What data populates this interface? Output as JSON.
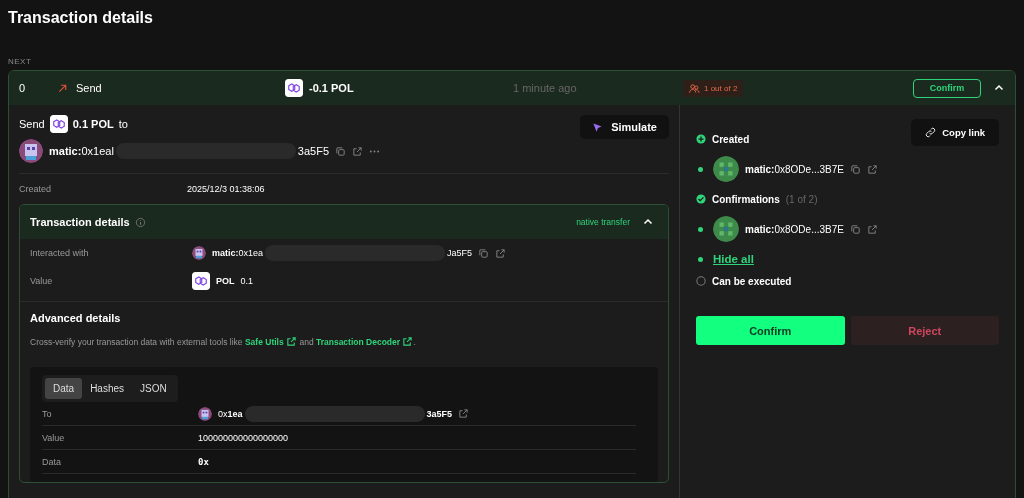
{
  "page_title": "Transaction details",
  "queue_label": "NEXT",
  "transaction": {
    "nonce": "0",
    "type": "Send",
    "amount": "-0.1 POL",
    "time": "1 minute ago",
    "signers": "1 out of 2",
    "confirm_button": "Confirm",
    "expanded": true
  },
  "summary": {
    "verb": "Send",
    "amount": "0.1 POL",
    "preposition": "to",
    "address_start": "**matic:**0x1eal",
    "address_end": "3a5F5",
    "simulate": "Simulate"
  },
  "created": {
    "label": "Created",
    "value": "2025/12/3 01:38:06"
  },
  "details": {
    "title": "Transaction details",
    "badge": "native transfer",
    "expanded": true,
    "rows": [
      {
        "label": "Interacted with",
        "kind": "address",
        "address_start": "**matic:**0x1ea",
        "address_end": "Ja5F5"
      },
      {
        "label": "Value",
        "kind": "token",
        "token": "POL",
        "value": "0.1"
      }
    ]
  },
  "advanced": {
    "title": "Advanced details",
    "text_before": "Cross-verify your transaction data with external tools like ",
    "joiner": " and ",
    "end": ".",
    "links": [
      "Safe Utils",
      "Transaction Decoder"
    ]
  },
  "data_tabs": [
    {
      "label": "Data",
      "selected": true
    },
    {
      "label": "Hashes",
      "selected": false
    },
    {
      "label": "JSON",
      "selected": false
    }
  ],
  "data_rows": [
    {
      "label": "To",
      "kind": "address",
      "address_start": "0x**1ea**",
      "address_end": "**3a5F5**"
    },
    {
      "label": "Value",
      "kind": "text",
      "value": "100000000000000000"
    },
    {
      "label": "Data",
      "kind": "mono",
      "value": "0x"
    }
  ],
  "copy_link": "Copy link",
  "timeline": [
    {
      "kind": "created",
      "label": "Created"
    },
    {
      "kind": "signer",
      "address": "**matic:**0x8ODe...3B7E"
    },
    {
      "kind": "confirmed",
      "label": "Confirmations",
      "note": "(1 of 2)"
    },
    {
      "kind": "signer",
      "address": "**matic:**0x8ODe...3B7E"
    },
    {
      "kind": "link",
      "label": "Hide all"
    },
    {
      "kind": "pending",
      "label": "Can be executed"
    }
  ],
  "actions": [
    {
      "kind": "primary",
      "label": "Confirm"
    },
    {
      "kind": "danger",
      "label": "Reject"
    }
  ]
}
